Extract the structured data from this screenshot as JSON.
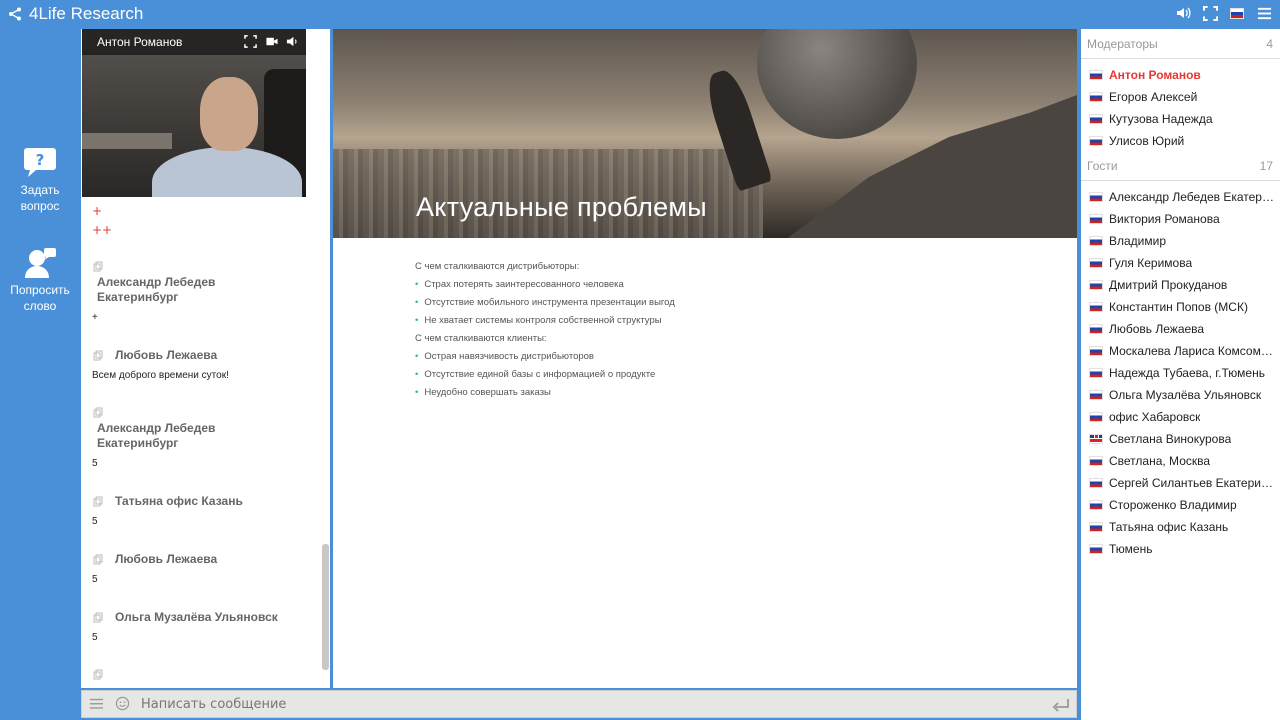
{
  "app": {
    "title": "4Life Research"
  },
  "left_rail": {
    "ask_question": "Задать вопрос",
    "request_speech": "Попросить слово"
  },
  "video": {
    "presenter": "Антон Романов"
  },
  "chat": {
    "messages": [
      {
        "text": "+"
      },
      {
        "text": "++"
      },
      {
        "author": "Александр Лебедев Екатеринбург",
        "text": "+"
      },
      {
        "author": "Любовь Лежаева",
        "text": "Всем доброго времени суток!"
      },
      {
        "author": "Александр Лебедев Екатеринбург",
        "text": "5"
      },
      {
        "author": "Татьяна офис Казань",
        "text": "5"
      },
      {
        "author": "Любовь Лежаева",
        "text": "5"
      },
      {
        "author": "Ольга Музалёва Ульяновск",
        "text": "5"
      }
    ],
    "author_lines": {
      "alex_line1": "Александр Лебедев",
      "alex_line2": "Екатеринбург"
    }
  },
  "composer": {
    "placeholder": "Написать сообщение"
  },
  "slide": {
    "title": "Актуальные проблемы",
    "heading1": "С чем сталкиваются дистрибьюторы:",
    "list1": [
      "Страх потерять заинтересованного человека",
      "Отсутствие мобильного инструмента презентации выгод",
      "Не хватает системы контроля собственной структуры"
    ],
    "heading2": "С чем сталкиваются клиенты:",
    "list2": [
      "Острая навязчивость дистрибьюторов",
      "Отсутствие единой базы с информацией о продукте",
      "Неудобно совершать заказы"
    ]
  },
  "participants": {
    "moderators_label": "Модераторы",
    "moderators_count": "4",
    "moderators": [
      {
        "name": "Антон Романов",
        "flag": "ru"
      },
      {
        "name": "Егоров Алексей",
        "flag": "ru"
      },
      {
        "name": "Кутузова Надежда",
        "flag": "ru"
      },
      {
        "name": "Улисов Юрий",
        "flag": "ru"
      }
    ],
    "guests_label": "Гости",
    "guests_count": "17",
    "guests": [
      {
        "name": "Александр Лебедев Екатеринбург",
        "flag": "ru"
      },
      {
        "name": "Виктория Романова",
        "flag": "ru"
      },
      {
        "name": "Владимир",
        "flag": "ru"
      },
      {
        "name": "Гуля Керимова",
        "flag": "ru"
      },
      {
        "name": "Дмитрий Прокуданов",
        "flag": "ru"
      },
      {
        "name": "Константин Попов (МСК)",
        "flag": "ru"
      },
      {
        "name": "Любовь Лежаева",
        "flag": "ru"
      },
      {
        "name": "Москалева Лариса Комсомольск",
        "flag": "ru"
      },
      {
        "name": "Надежда Тубаева, г.Тюмень",
        "flag": "ru"
      },
      {
        "name": "Ольга Музалёва Ульяновск",
        "flag": "ru"
      },
      {
        "name": "офис Хабаровск",
        "flag": "ru"
      },
      {
        "name": "Светлана Винокурова",
        "flag": "gb"
      },
      {
        "name": "Светлана, Москва",
        "flag": "ru"
      },
      {
        "name": "Сергей Силантьев Екатеринбург",
        "flag": "ru"
      },
      {
        "name": "Стороженко Владимир",
        "flag": "ru"
      },
      {
        "name": "Татьяна офис Казань",
        "flag": "ru"
      },
      {
        "name": "Тюмень",
        "flag": "ru"
      }
    ]
  },
  "colors": {
    "background": "#4a90d9",
    "moderator_self": "#e53935",
    "bullet": "#2bb3a3"
  }
}
